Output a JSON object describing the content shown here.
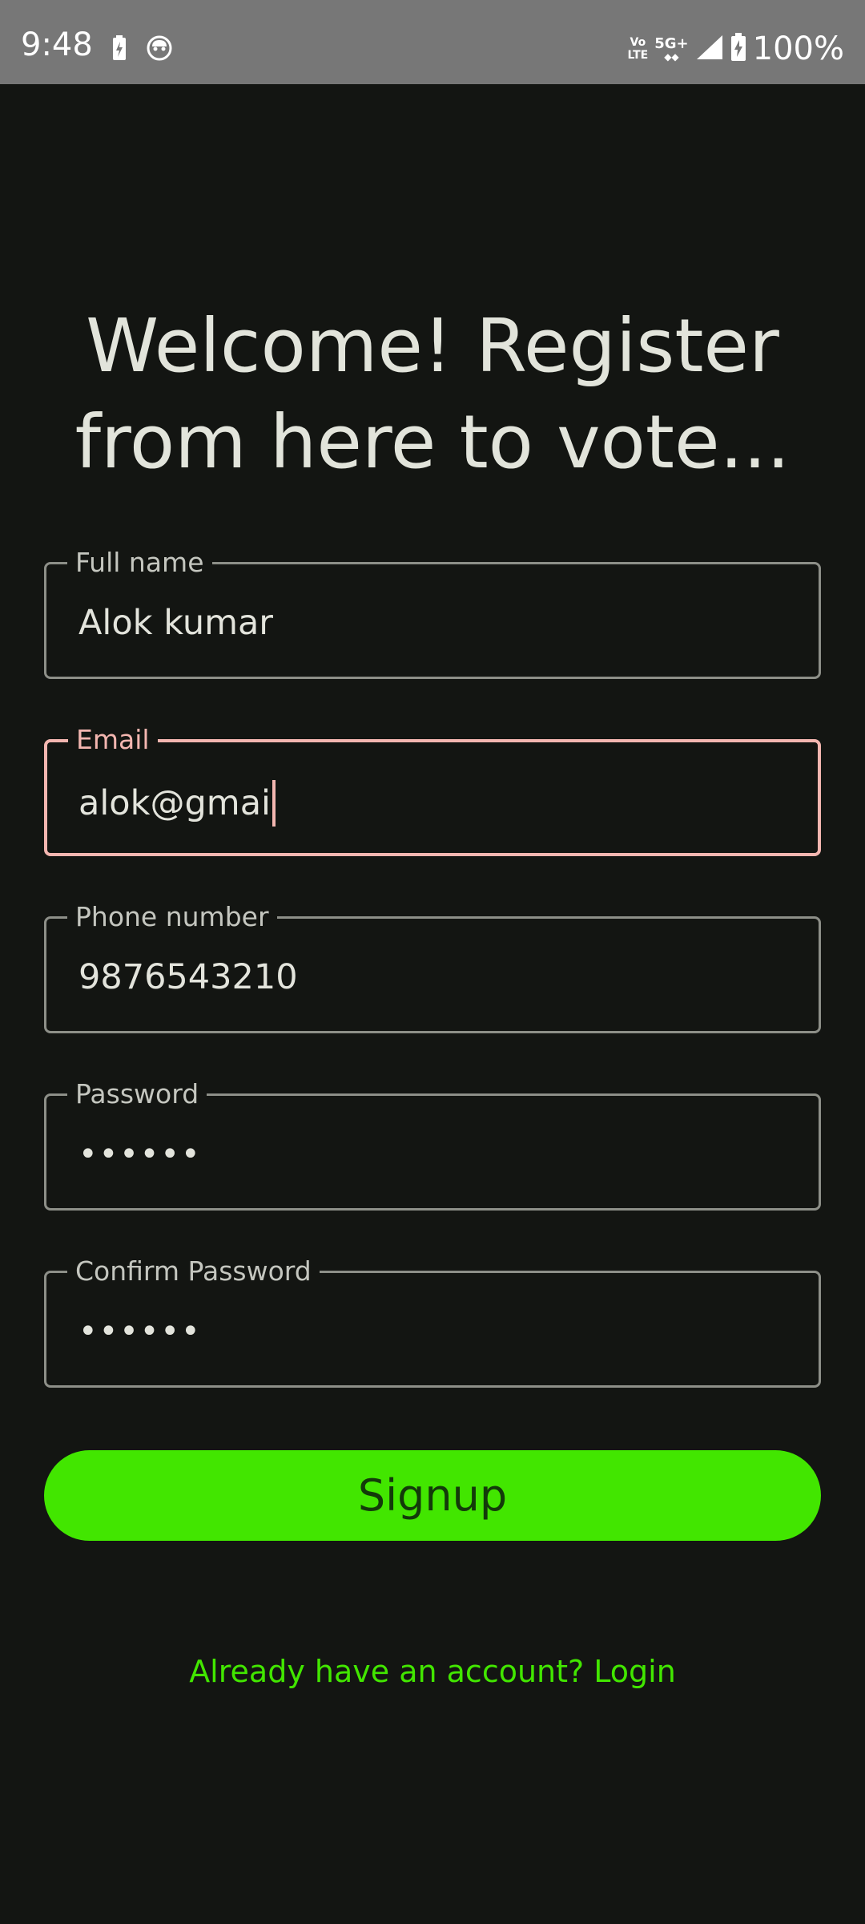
{
  "status_bar": {
    "time": "9:48",
    "network_top": "Vo",
    "network_bottom": "LTE",
    "network_5g": "5G+",
    "battery": "100%",
    "icons": [
      "battery-saver-icon",
      "cat-face-icon",
      "volte-icon",
      "5g-icon",
      "signal-icon",
      "battery-charging-icon"
    ]
  },
  "heading": {
    "line1": "Welcome! Register",
    "line2": "from here to vote..."
  },
  "form": {
    "full_name": {
      "label": "Full name",
      "value": "Alok kumar"
    },
    "email": {
      "label": "Email",
      "value": "alok@gmai"
    },
    "phone": {
      "label": "Phone number",
      "value": "9876543210"
    },
    "password": {
      "label": "Password",
      "value": "••••••"
    },
    "confirm_password": {
      "label": "Confirm Password",
      "value": "••••••"
    }
  },
  "signup_button": "Signup",
  "login_link": "Already have an account? Login",
  "colors": {
    "background": "#131512",
    "accent_green": "#42e600",
    "focus_pink": "#f3b6b0",
    "status_bar": "#777777"
  }
}
